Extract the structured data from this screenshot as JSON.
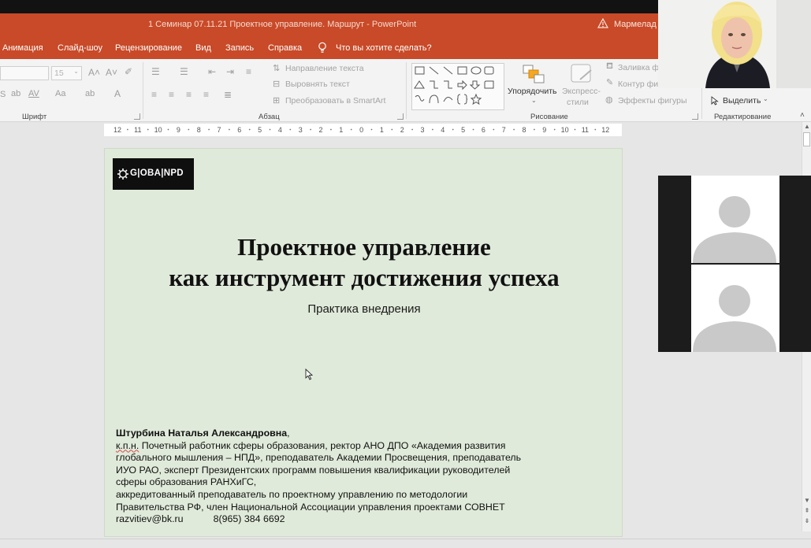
{
  "window": {
    "title": "1 Семинар 07.11.21 Проектное управление. Маршрут  -  PowerPoint",
    "user": "Мармелад"
  },
  "ribbon_tabs": [
    {
      "label": "Анимация"
    },
    {
      "label": "Слайд-шоу"
    },
    {
      "label": "Рецензирование"
    },
    {
      "label": "Вид"
    },
    {
      "label": "Запись"
    },
    {
      "label": "Справка"
    },
    {
      "label": "Что вы хотите сделать?"
    }
  ],
  "ribbon": {
    "font": {
      "size_value": "15",
      "group_label": "Шрифт"
    },
    "paragraph": {
      "text_direction": "Направление текста",
      "align_text": "Выровнять текст",
      "convert_smartart": "Преобразовать в SmartArt",
      "group_label": "Абзац"
    },
    "drawing": {
      "arrange": "Упорядочить",
      "quick_styles_line1": "Экспресс-",
      "quick_styles_line2": "стили",
      "shape_fill": "Заливка фи",
      "shape_outline": "Контур фи",
      "shape_effects": "Эффекты фигуры",
      "group_label": "Рисование"
    },
    "editing": {
      "select": "Выделить",
      "group_label": "Редактирование"
    }
  },
  "ruler": {
    "labels": [
      "12",
      "11",
      "10",
      "9",
      "8",
      "7",
      "6",
      "5",
      "4",
      "3",
      "2",
      "1",
      "0",
      "1",
      "2",
      "3",
      "4",
      "5",
      "6",
      "7",
      "8",
      "9",
      "10",
      "11",
      "12"
    ]
  },
  "slide": {
    "logo_text": "G|OBA|NPD",
    "title_line1": "Проектное управление",
    "title_line2": "как инструмент достижения успеха",
    "subtitle": "Практика внедрения",
    "author_name": "Штурбина Наталья Александровна",
    "author_comma": ",",
    "kpn": "к.п.н.",
    "line1_rest": " Почетный работник сферы образования, ректор АНО ДПО «Академия развития",
    "line2": "глобального мышления – НПД», преподаватель Академии Просвещения, преподаватель",
    "line3": "ИУО РАО, эксперт Президентских программ повышения квалификации руководителей",
    "line4": "сферы образования РАНХиГС,",
    "line5": "аккредитованный преподаватель по проектному управлению по методологии",
    "line6": "Правительства РФ, член Национальной Ассоциации управления проектами СОВНЕТ",
    "email": "razvitiev@bk.ru",
    "phone": "8(965) 384 6692"
  },
  "colors": {
    "title_bar": "#c84a28",
    "slide_bg": "#e0eada",
    "ribbon_bg": "#f3f3f3"
  }
}
